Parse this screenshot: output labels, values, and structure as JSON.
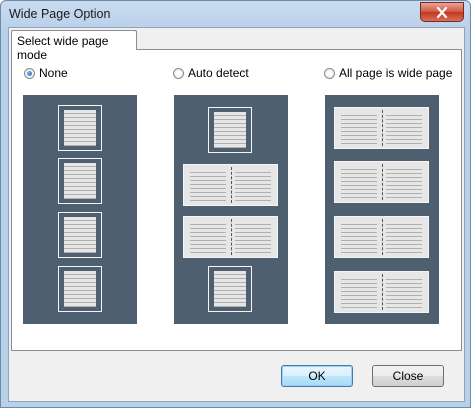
{
  "window": {
    "title": "Wide Page Option"
  },
  "tab": {
    "label": "Select wide page mode"
  },
  "modes": [
    {
      "label": "None",
      "checked": true
    },
    {
      "label": "Auto detect",
      "checked": false
    },
    {
      "label": "All page is wide page",
      "checked": false
    }
  ],
  "buttons": {
    "ok": "OK",
    "close": "Close"
  },
  "colors": {
    "preview_bg": "#4e5f70",
    "close_button": "#c2361e"
  }
}
